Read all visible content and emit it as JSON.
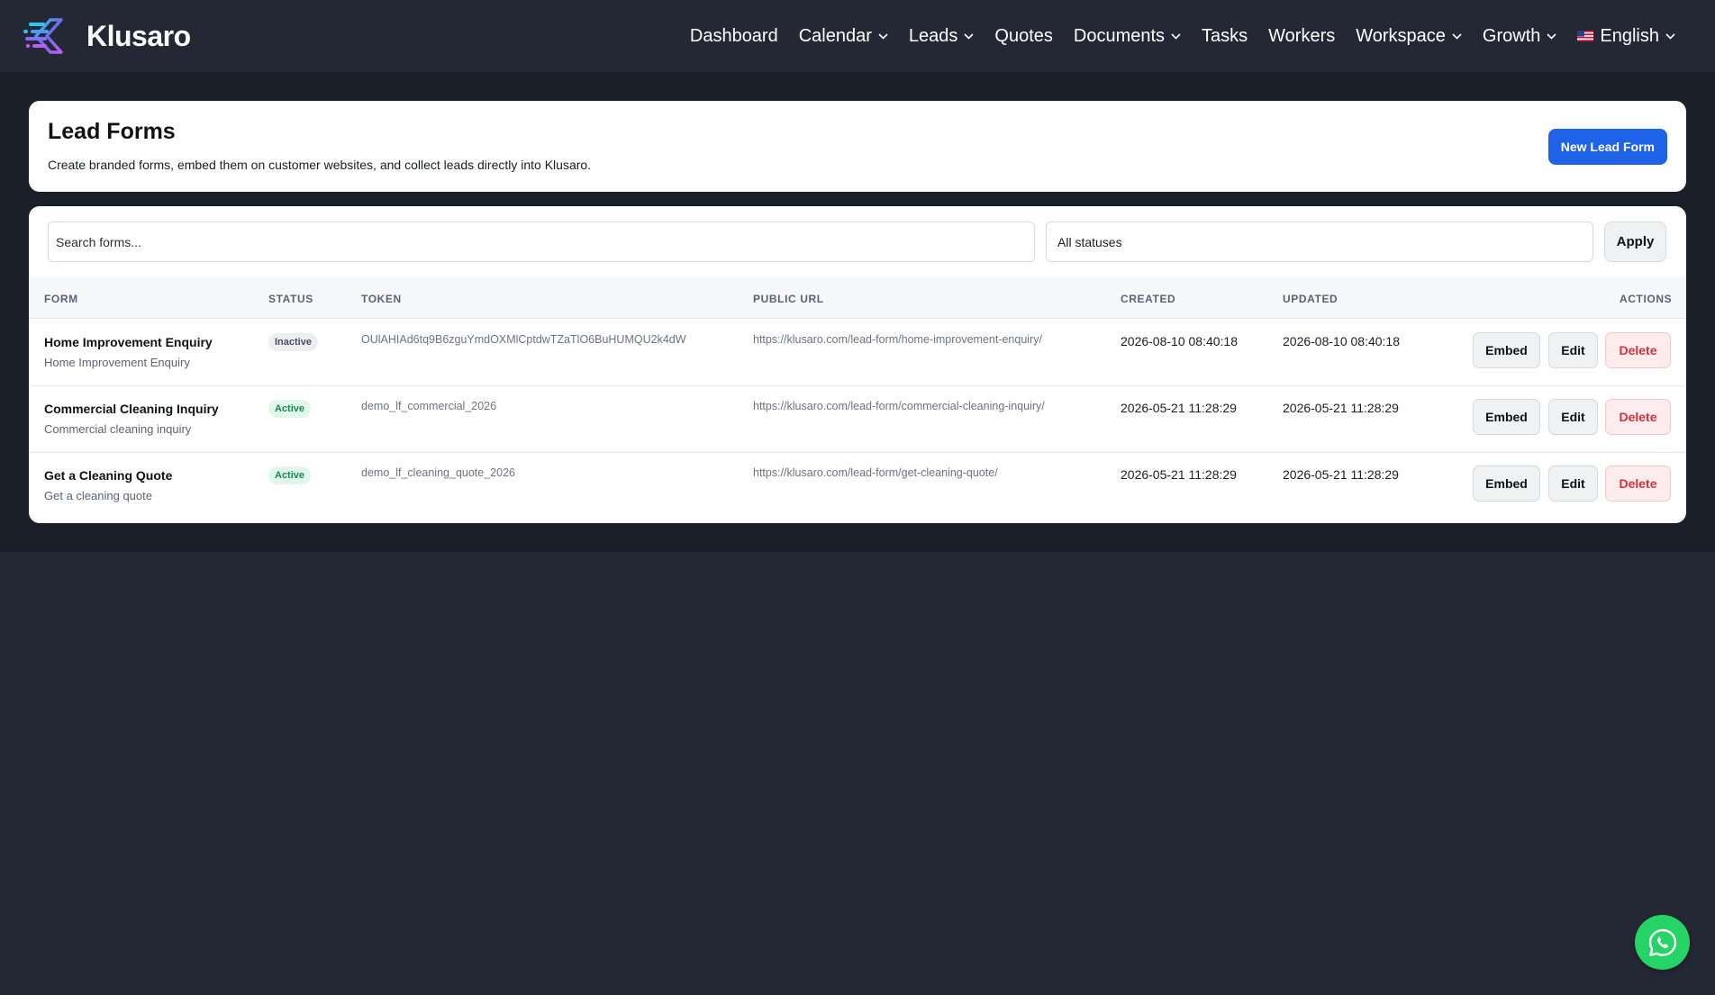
{
  "brand": {
    "name": "Klusaro"
  },
  "nav": {
    "items": [
      {
        "label": "Dashboard",
        "dropdown": false
      },
      {
        "label": "Calendar",
        "dropdown": true
      },
      {
        "label": "Leads",
        "dropdown": true
      },
      {
        "label": "Quotes",
        "dropdown": false
      },
      {
        "label": "Documents",
        "dropdown": true
      },
      {
        "label": "Tasks",
        "dropdown": false
      },
      {
        "label": "Workers",
        "dropdown": false
      },
      {
        "label": "Workspace",
        "dropdown": true
      },
      {
        "label": "Growth",
        "dropdown": true
      }
    ],
    "language": {
      "label": "English",
      "flag_icon": "us-flag-icon"
    }
  },
  "header": {
    "title": "Lead Forms",
    "subtitle": "Create branded forms, embed them on customer websites, and collect leads directly into Klusaro.",
    "new_button": "New Lead Form"
  },
  "filters": {
    "search_placeholder": "Search forms...",
    "status_selected": "All statuses",
    "apply_label": "Apply"
  },
  "table": {
    "columns": {
      "form": "FORM",
      "status": "STATUS",
      "token": "TOKEN",
      "public_url": "PUBLIC URL",
      "created": "CREATED",
      "updated": "UPDATED",
      "actions": "ACTIONS"
    },
    "rows": [
      {
        "name": "Home Improvement Enquiry",
        "subtitle": "Home Improvement Enquiry",
        "status": "Inactive",
        "token": "OUlAHIAd6tq9B6zguYmdOXMlCptdwTZaTlO6BuHUMQU2k4dW",
        "url": "https://klusaro.com/lead-form/home-improvement-enquiry/",
        "created": "2026-08-10 08:40:18",
        "updated": "2026-08-10 08:40:18"
      },
      {
        "name": "Commercial Cleaning Inquiry",
        "subtitle": "Commercial cleaning inquiry",
        "status": "Active",
        "token": "demo_lf_commercial_2026",
        "url": "https://klusaro.com/lead-form/commercial-cleaning-inquiry/",
        "created": "2026-05-21 11:28:29",
        "updated": "2026-05-21 11:28:29"
      },
      {
        "name": "Get a Cleaning Quote",
        "subtitle": "Get a cleaning quote",
        "status": "Active",
        "token": "demo_lf_cleaning_quote_2026",
        "url": "https://klusaro.com/lead-form/get-cleaning-quote/",
        "created": "2026-05-21 11:28:29",
        "updated": "2026-05-21 11:28:29"
      }
    ],
    "actions": {
      "embed": "Embed",
      "edit": "Edit",
      "delete": "Delete"
    }
  },
  "colors": {
    "background": "#232834",
    "content_background": "#1b1f29",
    "primary": "#1f63e8",
    "active_badge": "#138a52",
    "delete": "#d0313d",
    "whatsapp": "#25d366"
  },
  "floating": {
    "icon": "whatsapp-icon"
  }
}
